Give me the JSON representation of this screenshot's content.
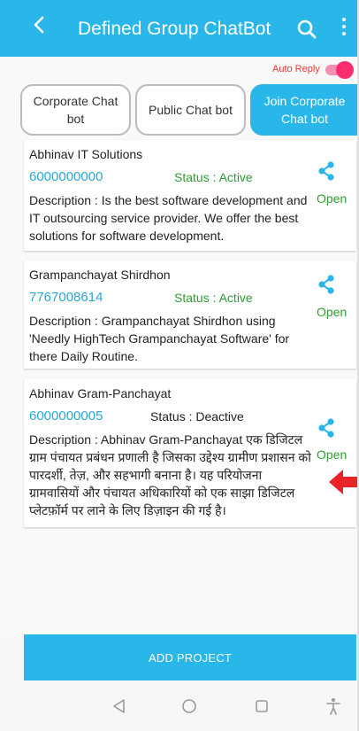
{
  "appbar": {
    "title": "Defined Group ChatBot",
    "back_icon": "chevron-left-icon",
    "search_icon": "search-icon",
    "more_icon": "more-vertical-icon",
    "color": "#29b6e8"
  },
  "auto_reply": {
    "label": "Auto Reply",
    "enabled": true,
    "color": "#ff2d6e"
  },
  "tabs": [
    {
      "label": "Corporate Chat bot",
      "active": false
    },
    {
      "label": "Public Chat bot",
      "active": false
    },
    {
      "label": "Join Corporate Chat bot",
      "active": true
    }
  ],
  "cards": [
    {
      "name": "Abhinav IT Solutions",
      "phone": "6000000000",
      "status": "Status : Active",
      "description": "Description : Is the best software development and IT outsourcing service provider. We offer the best solutions for software development.",
      "open_label": "Open"
    },
    {
      "name": "Grampanchayat Shirdhon",
      "phone": "7767008614",
      "status": "Status : Active",
      "description": "Description : Grampanchayat Shirdhon using 'Needly HighTech Grampanchayat Software' for there Daily Routine.",
      "open_label": "Open"
    },
    {
      "name": "Abhinav Gram-Panchayat",
      "phone": "6000000005",
      "status": "Status : Deactive",
      "description": "Description : Abhinav Gram-Panchayat एक डिजिटल ग्राम पंचायत प्रबंधन प्रणाली है जिसका उद्देश्य ग्रामीण प्रशासन को पारदर्शी, तेज़, और सहभागी बनाना है। यह परियोजना ग्रामवासियों और पंचायत अधिकारियों को एक साझा डिजिटल प्लेटफ़ॉर्म पर लाने के लिए डिज़ाइन की गई है।",
      "open_label": "Open"
    }
  ],
  "add_project_label": "ADD PROJECT",
  "colors": {
    "active_status": "#2e9e30",
    "phone": "#2aa7d6",
    "annotation_arrow": "#e8232a"
  },
  "nav": [
    "back-triangle-icon",
    "home-circle-icon",
    "recents-square-icon",
    "accessibility-icon"
  ]
}
